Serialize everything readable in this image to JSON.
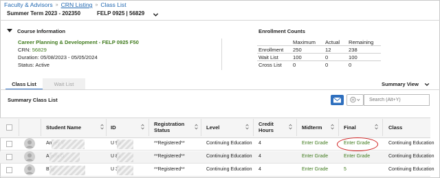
{
  "breadcrumb": {
    "items": [
      "Faculty & Advisors",
      "CRN Listing",
      "Class List"
    ],
    "separator": "»"
  },
  "termbar": {
    "term": "Summer Term 2023 - 202350",
    "course": "FELP 0925 | 56829"
  },
  "course_info": {
    "heading": "Course Information",
    "title": "Career Planning & Development - FELP 0925 F50",
    "crn_label": "CRN:",
    "crn_value": "56829",
    "duration": "Duration: 05/08/2023 - 05/05/2024",
    "status": "Status: Active"
  },
  "enrollment": {
    "heading": "Enrollment Counts",
    "columns": [
      "Maximum",
      "Actual",
      "Remaining"
    ],
    "rows": [
      {
        "label": "Enrollment",
        "values": [
          "250",
          "12",
          "238"
        ]
      },
      {
        "label": "Wait List",
        "values": [
          "100",
          "0",
          "100"
        ]
      },
      {
        "label": "Cross List",
        "values": [
          "0",
          "0",
          "0"
        ]
      }
    ]
  },
  "tabs": [
    {
      "label": "Class List",
      "active": true
    },
    {
      "label": "Wait List",
      "active": false
    }
  ],
  "summary_view_label": "Summary View",
  "summary_class_list": "Summary Class List",
  "search": {
    "placeholder": "Search (Alt+Y)"
  },
  "table": {
    "headers": {
      "student_name": "Student Name",
      "id": "ID",
      "reg_status_1": "Registration",
      "reg_status_2": "Status",
      "level": "Level",
      "credit_1": "Credit",
      "credit_2": "Hours",
      "midterm": "Midterm",
      "final": "Final",
      "class": "Class"
    },
    "rows": [
      {
        "name_visible": "An         rey V",
        "id_visible": "U          96",
        "reg_status": "**Registered**",
        "level": "Continuing Education",
        "credit": "4",
        "midterm": "Enter Grade",
        "final": "Enter Grade",
        "class": "Continuing Education"
      },
      {
        "name_visible": "A              echi O",
        "id_visible": "U          81",
        "reg_status": "**Registered**",
        "level": "Continuing Education",
        "credit": "4",
        "midterm": "Enter Grade",
        "final": "Enter Grade",
        "class": "Continuing Education"
      },
      {
        "name_visible": "B                ig",
        "id_visible": "U          33",
        "reg_status": "**Registered**",
        "level": "Continuing Education",
        "credit": "4",
        "midterm": "Enter Grade",
        "final": "5",
        "class": "Continuing Education"
      }
    ]
  },
  "colors": {
    "link_blue": "#1f66b0",
    "grade_green": "#3f7a1c",
    "tab_accent": "#2d6ec4",
    "mail_button": "#2e6fbe",
    "highlight_circle": "#d02020"
  },
  "icons": [
    "chevron-down-icon",
    "caret-down-icon",
    "mail-icon",
    "filter-icon",
    "sort-icon",
    "avatar-icon"
  ]
}
